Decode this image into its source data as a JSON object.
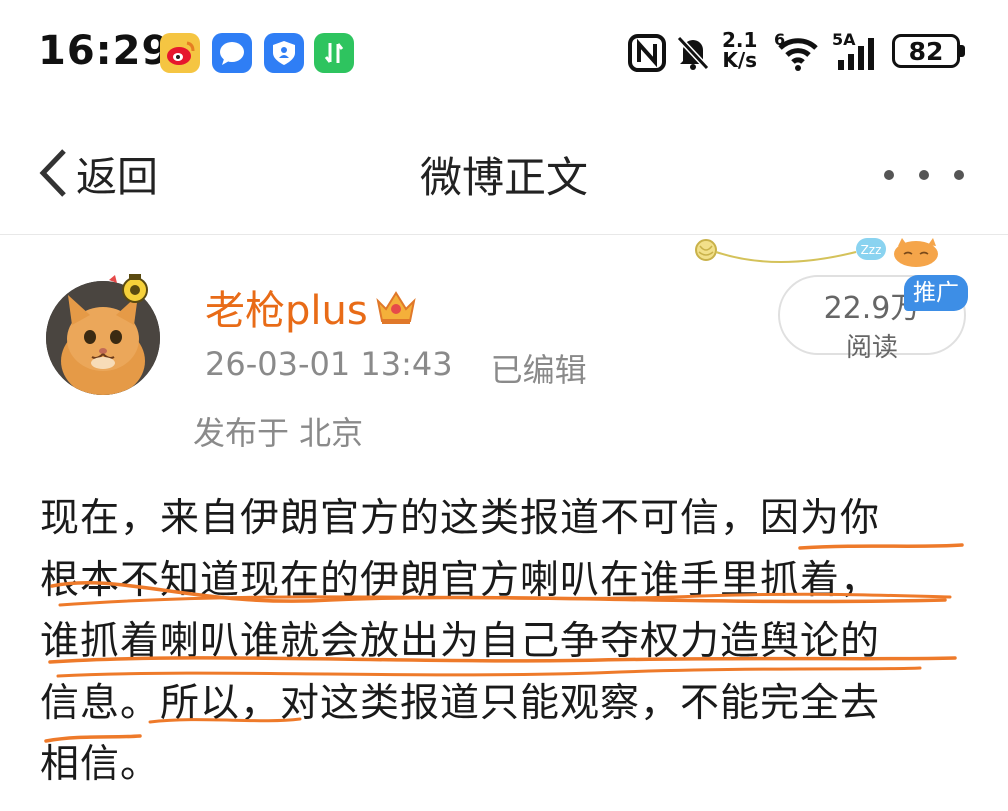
{
  "status_bar": {
    "time": "16:29",
    "network_speed_value": "2.1",
    "network_speed_unit": "K/s",
    "wifi_badge": "6",
    "signal_label": "5A",
    "battery": "82",
    "apps": [
      "weibo-icon",
      "message-icon",
      "shield-icon",
      "transfer-icon"
    ]
  },
  "nav": {
    "back_label": "返回",
    "title": "微博正文"
  },
  "post": {
    "username": "老枪plus",
    "timestamp": "26-03-01 13:43",
    "edited": "已编辑",
    "location": "发布于 北京",
    "reads_count": "22.9万",
    "reads_label": "阅读",
    "promo_badge": "推广",
    "decoration_text": "Zzz",
    "lines": [
      "现在，来自伊朗官方的这类报道不可信，因为你",
      "根本不知道现在的伊朗官方喇叭在谁手里抓着，",
      "谁抓着喇叭谁就会放出为自己争夺权力造舆论的",
      "信息。所以，对这类报道只能观察，不能完全去",
      "相信。"
    ]
  },
  "colors": {
    "accent_orange": "#e86b17",
    "annotation_orange": "#ee7a2a",
    "promo_blue": "#3d8ee6"
  }
}
